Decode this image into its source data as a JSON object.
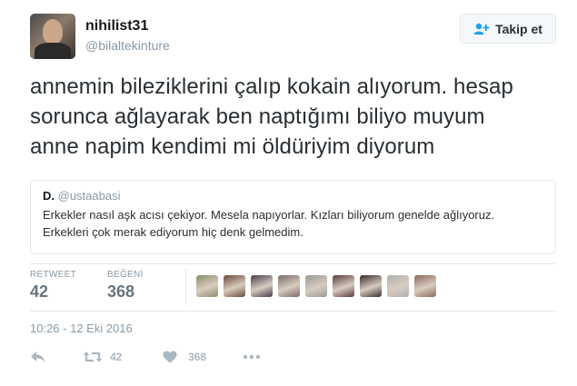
{
  "user": {
    "name": "nihilist31",
    "handle": "@bilaltekinture"
  },
  "follow_button": {
    "label": "Takip et",
    "icon": "follow-person-plus-icon"
  },
  "tweet": {
    "text": "annemin bileziklerini çalıp kokain alıyorum. hesap\nsorunca ağlayarak ben naptığımı biliyo muyum\nanne napim kendimi mi öldüriyim diyorum"
  },
  "quote": {
    "author_name": "D.",
    "author_handle": "@ustaabasi",
    "text": "Erkekler nasıl aşk acısı çekiyor. Mesela napıyorlar. Kızları biliyorum genelde ağlıyoruz.\nErkekleri çok merak ediyorum hiç denk gelmedim."
  },
  "stats": {
    "retweet_label": "RETWEET",
    "retweet_count": "42",
    "like_label": "BEĞENİ",
    "like_count": "368"
  },
  "likers": [
    {
      "name": "liker-avatar",
      "color": "#8a8f6a"
    },
    {
      "name": "liker-avatar",
      "color": "#6b4a3a"
    },
    {
      "name": "liker-avatar",
      "color": "#4a3a4a"
    },
    {
      "name": "liker-avatar",
      "color": "#7a6a6a"
    },
    {
      "name": "liker-avatar",
      "color": "#9a9a9a"
    },
    {
      "name": "liker-avatar",
      "color": "#5a3a3a"
    },
    {
      "name": "liker-avatar",
      "color": "#3a2a2a"
    },
    {
      "name": "liker-avatar",
      "color": "#b0b0b0"
    },
    {
      "name": "liker-avatar",
      "color": "#8a6a5a"
    }
  ],
  "timestamp": "10:26 - 12 Eki 2016",
  "actions": {
    "reply_icon": "reply-icon",
    "retweet_icon": "retweet-icon",
    "retweet_count": "42",
    "like_icon": "heart-icon",
    "like_count": "368",
    "more_icon": "more-dots-icon"
  },
  "colors": {
    "text": "#292f33",
    "muted": "#8899a6",
    "action_gray": "#aab8c2",
    "border": "#e1e8ed",
    "follow_icon": "#1da1f2"
  }
}
